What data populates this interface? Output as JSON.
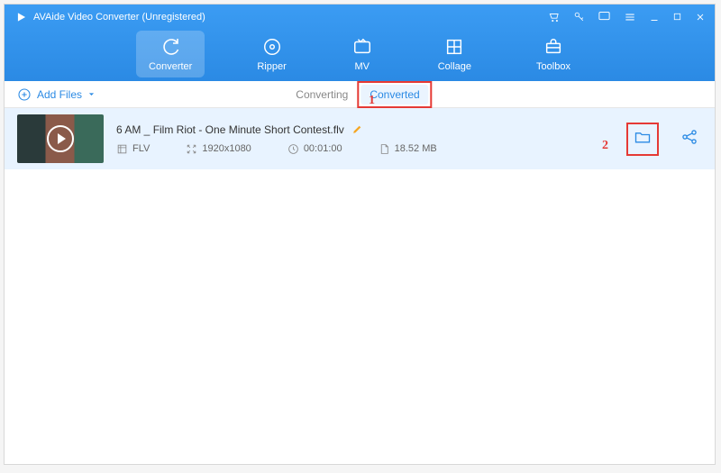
{
  "app": {
    "title": "AVAide Video Converter (Unregistered)"
  },
  "nav": {
    "converter": "Converter",
    "ripper": "Ripper",
    "mv": "MV",
    "collage": "Collage",
    "toolbox": "Toolbox"
  },
  "toolbar": {
    "add_files": "Add Files",
    "tab_converting": "Converting",
    "tab_converted": "Converted"
  },
  "file": {
    "name": "6 AM _ Film Riot - One Minute Short Contest.flv",
    "format": "FLV",
    "resolution": "1920x1080",
    "duration": "00:01:00",
    "size": "18.52 MB"
  },
  "annotations": {
    "one": "1",
    "two": "2"
  }
}
